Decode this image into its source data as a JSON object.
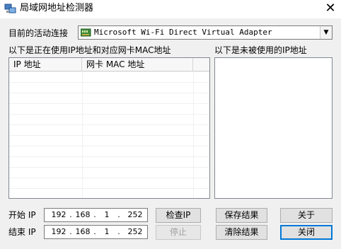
{
  "window": {
    "title": "局域网地址检测器",
    "close_glyph": "✕"
  },
  "adapter": {
    "label": "目前的活动连接",
    "selected": "Microsoft Wi-Fi Direct Virtual Adapter",
    "icon": "network-adapter-icon"
  },
  "used_ips": {
    "label": "以下是正在使用IP地址和对应网卡MAC地址",
    "columns": [
      "IP 地址",
      "网卡 MAC 地址"
    ]
  },
  "unused_ips": {
    "label": "以下是未被使用的IP地址"
  },
  "start_ip": {
    "label": "开始 IP",
    "octets": [
      "192",
      "168",
      "1",
      "252"
    ]
  },
  "end_ip": {
    "label": "结束 IP",
    "octets": [
      "192",
      "168",
      "1",
      "252"
    ]
  },
  "buttons": {
    "check": "检查IP",
    "stop": "停止",
    "save": "保存结果",
    "clear": "清除结果",
    "about": "关于",
    "close": "关闭"
  },
  "colors": {
    "window_bg": "#f0f0f0",
    "focus_border": "#0078d7"
  }
}
